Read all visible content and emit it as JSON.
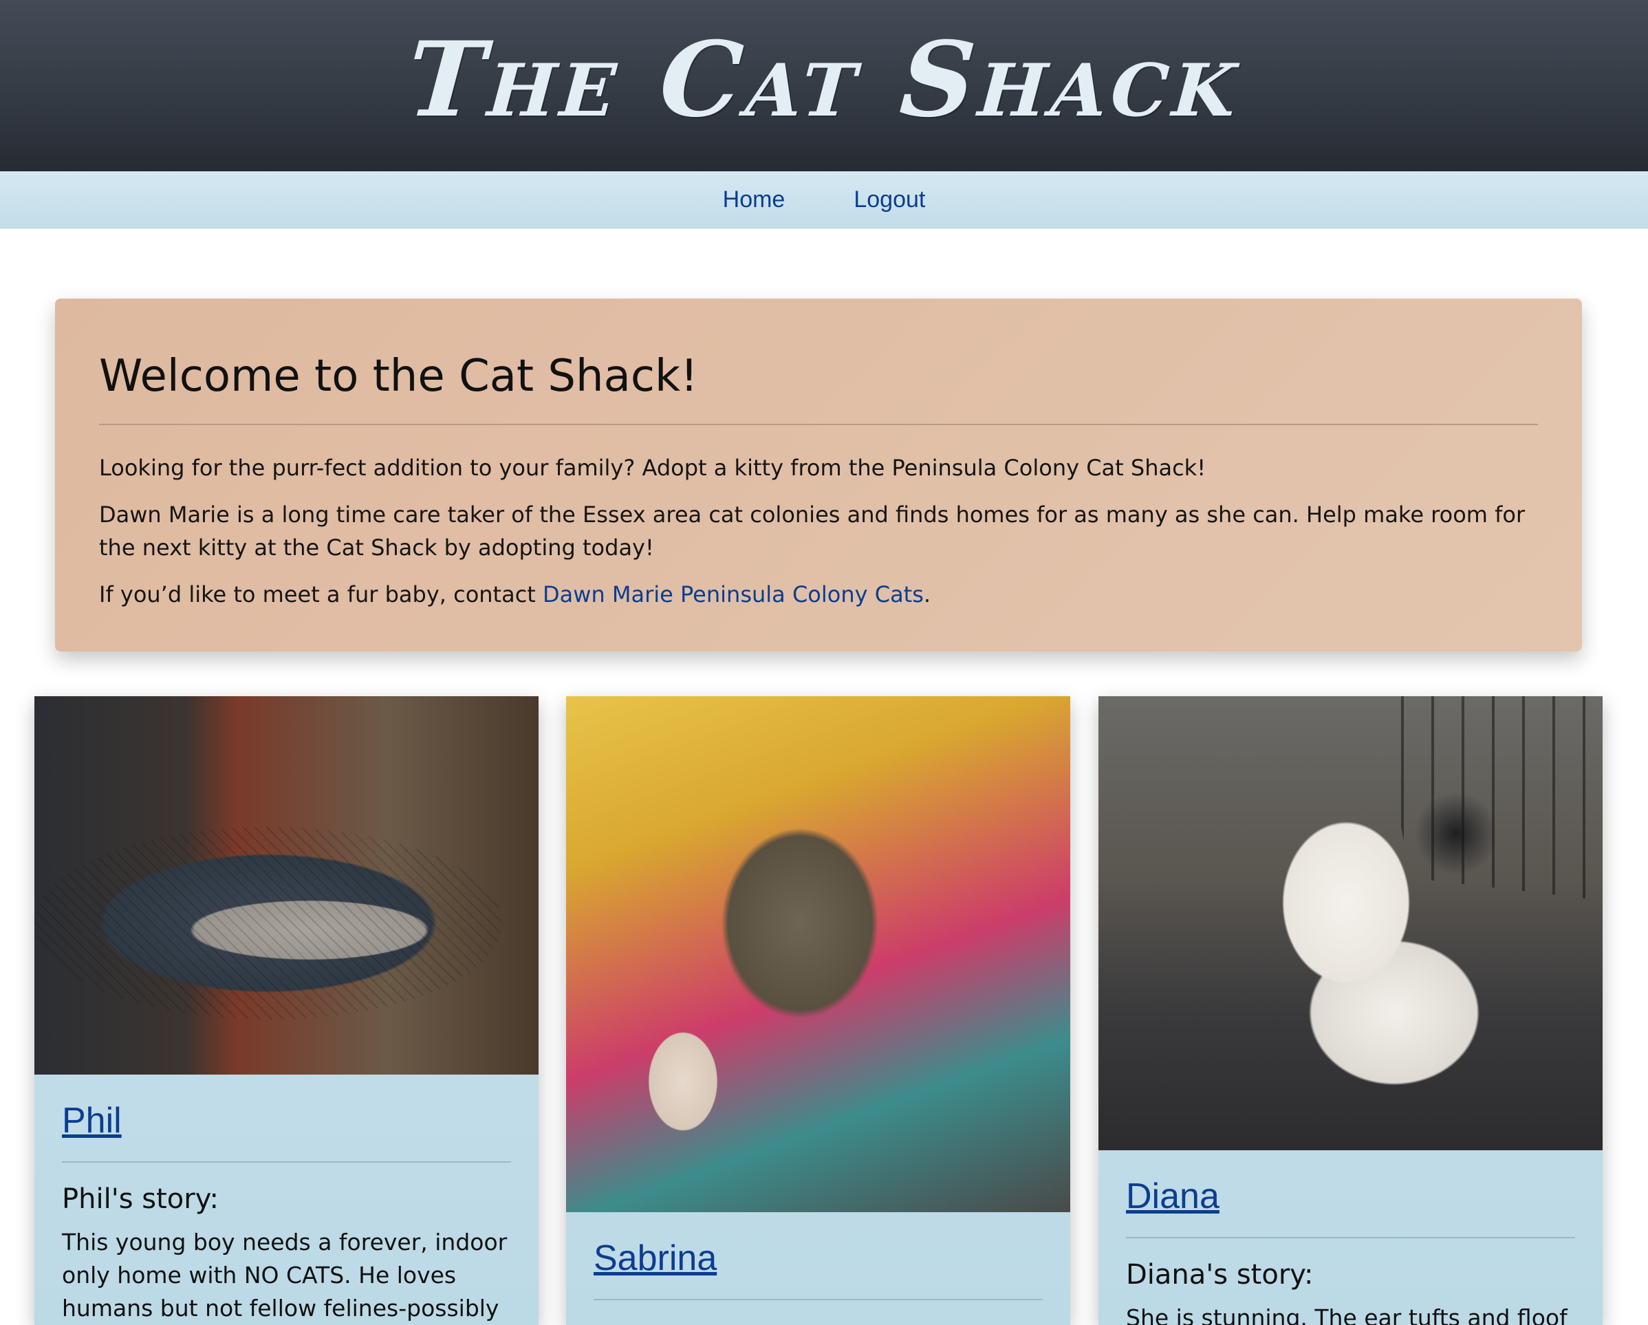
{
  "header": {
    "title": "The Cat Shack"
  },
  "nav": {
    "items": [
      "Home",
      "Logout"
    ]
  },
  "welcome": {
    "heading": "Welcome to the Cat Shack!",
    "p1": "Looking for the purr-fect addition to your family? Adopt a kitty from the Peninsula Colony Cat Shack!",
    "p2": "Dawn Marie is a long time care taker of the Essex area cat colonies and finds homes for as many as she can. Help make room for the next kitty at the Cat Shack by adopting today!",
    "p3_prefix": "If you’d like to meet a fur baby, contact ",
    "p3_link": "Dawn Marie Peninsula Colony Cats",
    "p3_suffix": "."
  },
  "cats": [
    {
      "name": "Phil",
      "story_heading": "Phil's story:",
      "story": "This young boy needs a forever, indoor only home with NO CATS. He loves humans but not fellow felines-possibly"
    },
    {
      "name": "Sabrina"
    },
    {
      "name": "Diana",
      "story_heading": "Diana's story:",
      "story": "She is stunning. The ear tufts and floof"
    }
  ]
}
